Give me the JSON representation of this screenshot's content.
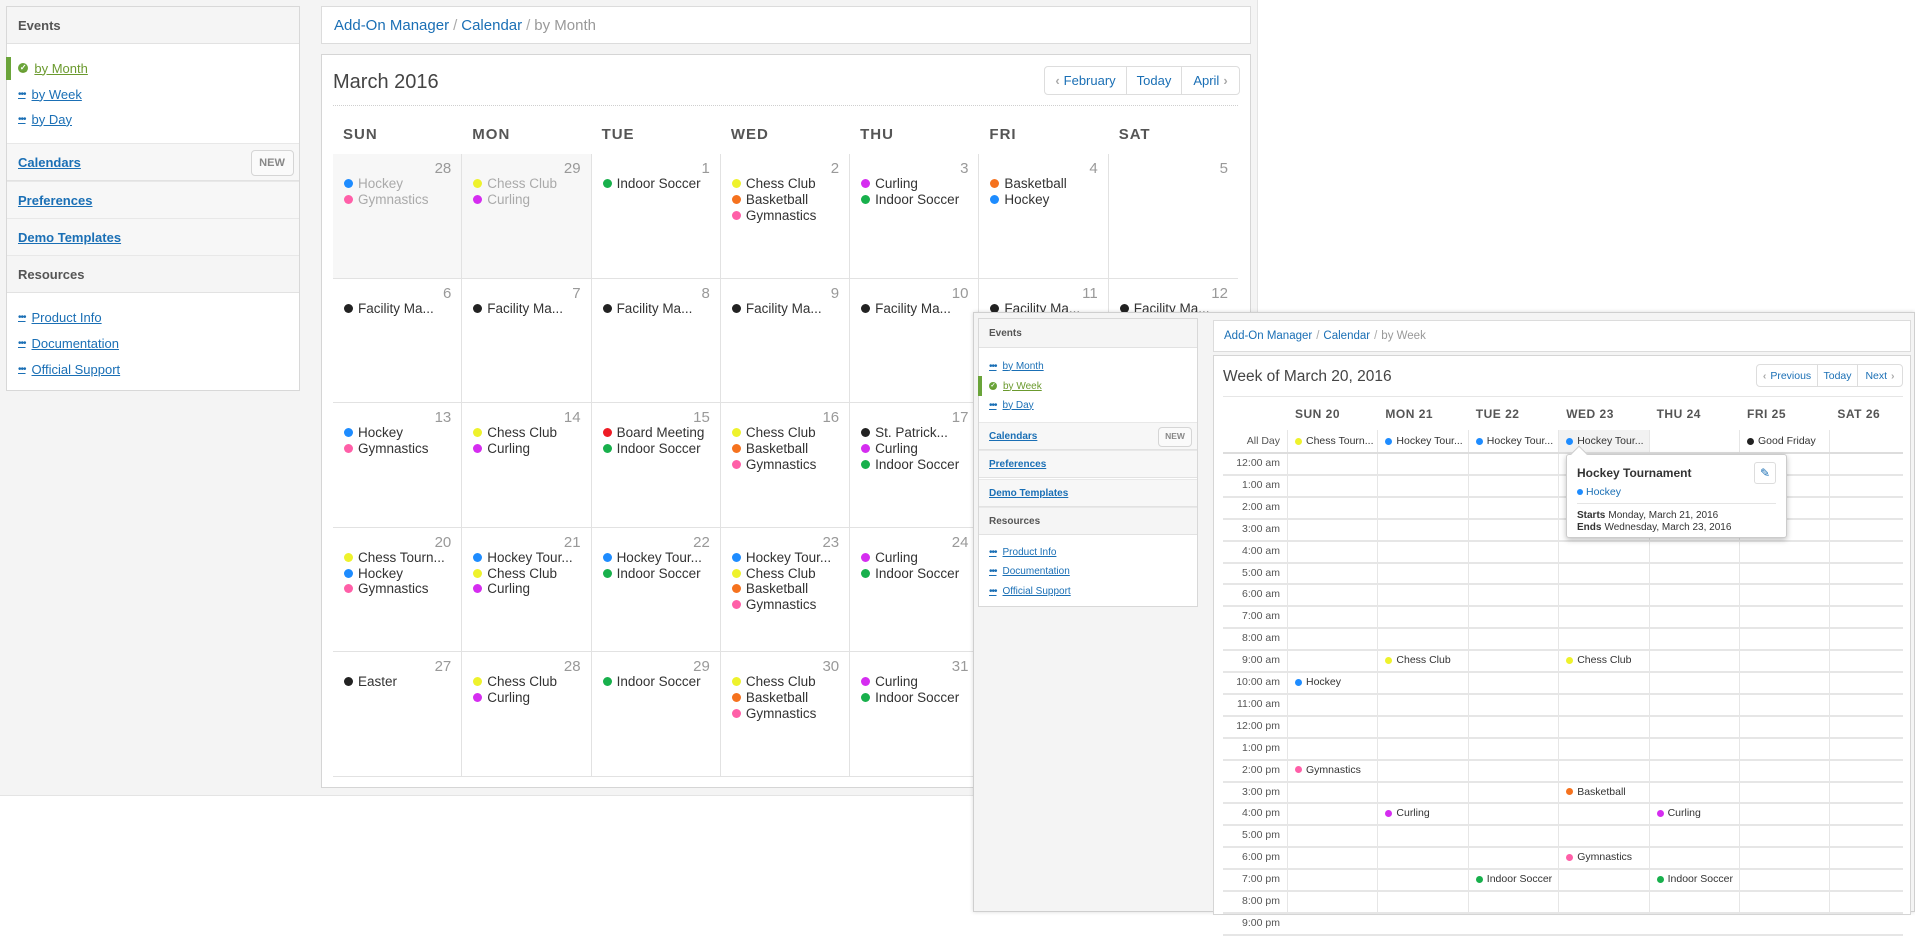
{
  "colors": {
    "accent": "#6aa43a",
    "link": "#1a6fb5",
    "Hockey": "#1e8cff",
    "Gymnastics": "#ff5fa8",
    "Chess Club": "#eef22c",
    "Curling": "#d52df0",
    "Indoor Soccer": "#18b04c",
    "Basketball": "#f5721e",
    "Board Meeting": "#ee1c25",
    "Other": "#222222"
  },
  "month_view": {
    "sidebar": {
      "events_header": "Events",
      "links": [
        {
          "label": "by Month",
          "active": true,
          "icon": "check-circle-icon"
        },
        {
          "label": "by Week",
          "active": false,
          "icon": "dots-icon"
        },
        {
          "label": "by Day",
          "active": false,
          "icon": "dots-icon"
        }
      ],
      "calendars": "Calendars",
      "new_button": "NEW",
      "preferences": "Preferences",
      "demo_templates": "Demo Templates",
      "resources_header": "Resources",
      "resources": [
        "Product Info",
        "Documentation",
        "Official Support"
      ]
    },
    "breadcrumb": {
      "item1": "Add-On Manager",
      "item2": "Calendar",
      "current": "by Month",
      "separator": "/"
    },
    "title": "March 2016",
    "nav": {
      "prev": "February",
      "today": "Today",
      "next": "April"
    },
    "weekdays": [
      "SUN",
      "MON",
      "TUE",
      "WED",
      "THU",
      "FRI",
      "SAT"
    ],
    "cells": [
      {
        "day": "28",
        "other": true,
        "events": [
          [
            "Hockey",
            "Hockey"
          ],
          [
            "Gymnastics",
            "Gymnastics"
          ]
        ]
      },
      {
        "day": "29",
        "other": true,
        "events": [
          [
            "Chess Club",
            "Chess Club"
          ],
          [
            "Curling",
            "Curling"
          ]
        ]
      },
      {
        "day": "1",
        "events": [
          [
            "Indoor Soccer",
            "Indoor Soccer"
          ]
        ]
      },
      {
        "day": "2",
        "events": [
          [
            "Chess Club",
            "Chess Club"
          ],
          [
            "Basketball",
            "Basketball"
          ],
          [
            "Gymnastics",
            "Gymnastics"
          ]
        ]
      },
      {
        "day": "3",
        "events": [
          [
            "Curling",
            "Curling"
          ],
          [
            "Indoor Soccer",
            "Indoor Soccer"
          ]
        ]
      },
      {
        "day": "4",
        "events": [
          [
            "Basketball",
            "Basketball"
          ],
          [
            "Hockey",
            "Hockey"
          ]
        ]
      },
      {
        "day": "5",
        "events": []
      },
      {
        "day": "6",
        "events": [
          [
            "Facility Ma...",
            "Other"
          ]
        ]
      },
      {
        "day": "7",
        "events": [
          [
            "Facility Ma...",
            "Other"
          ]
        ]
      },
      {
        "day": "8",
        "events": [
          [
            "Facility Ma...",
            "Other"
          ]
        ]
      },
      {
        "day": "9",
        "events": [
          [
            "Facility Ma...",
            "Other"
          ]
        ]
      },
      {
        "day": "10",
        "events": [
          [
            "Facility Ma...",
            "Other"
          ]
        ]
      },
      {
        "day": "11",
        "events": [
          [
            "Facility Ma...",
            "Other"
          ]
        ]
      },
      {
        "day": "12",
        "events": [
          [
            "Facility Ma...",
            "Other"
          ]
        ]
      },
      {
        "day": "13",
        "events": [
          [
            "Hockey",
            "Hockey"
          ],
          [
            "Gymnastics",
            "Gymnastics"
          ]
        ]
      },
      {
        "day": "14",
        "events": [
          [
            "Chess Club",
            "Chess Club"
          ],
          [
            "Curling",
            "Curling"
          ]
        ]
      },
      {
        "day": "15",
        "events": [
          [
            "Board Meeting",
            "Board Meeting"
          ],
          [
            "Indoor Soccer",
            "Indoor Soccer"
          ]
        ]
      },
      {
        "day": "16",
        "events": [
          [
            "Chess Club",
            "Chess Club"
          ],
          [
            "Basketball",
            "Basketball"
          ],
          [
            "Gymnastics",
            "Gymnastics"
          ]
        ]
      },
      {
        "day": "17",
        "events": [
          [
            "St. Patrick...",
            "Other"
          ],
          [
            "Curling",
            "Curling"
          ],
          [
            "Indoor Soccer",
            "Indoor Soccer"
          ]
        ]
      },
      {
        "day": "",
        "events": []
      },
      {
        "day": "",
        "events": []
      },
      {
        "day": "20",
        "events": [
          [
            "Chess Tourn...",
            "Chess Club"
          ],
          [
            "Hockey",
            "Hockey"
          ],
          [
            "Gymnastics",
            "Gymnastics"
          ]
        ]
      },
      {
        "day": "21",
        "events": [
          [
            "Hockey Tour...",
            "Hockey"
          ],
          [
            "Chess Club",
            "Chess Club"
          ],
          [
            "Curling",
            "Curling"
          ]
        ]
      },
      {
        "day": "22",
        "events": [
          [
            "Hockey Tour...",
            "Hockey"
          ],
          [
            "Indoor Soccer",
            "Indoor Soccer"
          ]
        ]
      },
      {
        "day": "23",
        "events": [
          [
            "Hockey Tour...",
            "Hockey"
          ],
          [
            "Chess Club",
            "Chess Club"
          ],
          [
            "Basketball",
            "Basketball"
          ],
          [
            "Gymnastics",
            "Gymnastics"
          ]
        ]
      },
      {
        "day": "24",
        "events": [
          [
            "Curling",
            "Curling"
          ],
          [
            "Indoor Soccer",
            "Indoor Soccer"
          ]
        ]
      },
      {
        "day": "",
        "events": []
      },
      {
        "day": "",
        "events": []
      },
      {
        "day": "27",
        "events": [
          [
            "Easter",
            "Other"
          ]
        ]
      },
      {
        "day": "28",
        "events": [
          [
            "Chess Club",
            "Chess Club"
          ],
          [
            "Curling",
            "Curling"
          ]
        ]
      },
      {
        "day": "29",
        "events": [
          [
            "Indoor Soccer",
            "Indoor Soccer"
          ]
        ]
      },
      {
        "day": "30",
        "events": [
          [
            "Chess Club",
            "Chess Club"
          ],
          [
            "Basketball",
            "Basketball"
          ],
          [
            "Gymnastics",
            "Gymnastics"
          ]
        ]
      },
      {
        "day": "31",
        "events": [
          [
            "Curling",
            "Curling"
          ],
          [
            "Indoor Soccer",
            "Indoor Soccer"
          ]
        ]
      },
      {
        "day": "",
        "events": []
      },
      {
        "day": "",
        "events": []
      }
    ]
  },
  "week_view": {
    "sidebar": {
      "events_header": "Events",
      "links": [
        {
          "label": "by Month",
          "active": false,
          "icon": "dots-icon"
        },
        {
          "label": "by Week",
          "active": true,
          "icon": "check-circle-icon"
        },
        {
          "label": "by Day",
          "active": false,
          "icon": "dots-icon"
        }
      ],
      "calendars": "Calendars",
      "new_button": "NEW",
      "preferences": "Preferences",
      "demo_templates": "Demo Templates",
      "resources_header": "Resources",
      "resources": [
        "Product Info",
        "Documentation",
        "Official Support"
      ]
    },
    "breadcrumb": {
      "item1": "Add-On Manager",
      "item2": "Calendar",
      "current": "by Week",
      "separator": "/"
    },
    "title": "Week of March 20, 2016",
    "nav": {
      "prev": "Previous",
      "today": "Today",
      "next": "Next"
    },
    "days": [
      "SUN 20",
      "MON 21",
      "TUE 22",
      "WED 23",
      "THU 24",
      "FRI 25",
      "SAT 26"
    ],
    "all_day_label": "All Day",
    "all_day": [
      [
        "Chess Tourn...",
        "Chess Club"
      ],
      [
        "Hockey Tour...",
        "Hockey"
      ],
      [
        "Hockey Tour...",
        "Hockey"
      ],
      [
        "Hockey Tour...",
        "Hockey"
      ],
      null,
      [
        "Good Friday",
        "Other"
      ],
      null
    ],
    "times": [
      "12:00 am",
      "1:00 am",
      "2:00 am",
      "3:00 am",
      "4:00 am",
      "5:00 am",
      "6:00 am",
      "7:00 am",
      "8:00 am",
      "9:00 am",
      "10:00 am",
      "11:00 am",
      "12:00 pm",
      "1:00 pm",
      "2:00 pm",
      "3:00 pm",
      "4:00 pm",
      "5:00 pm",
      "6:00 pm",
      "7:00 pm",
      "8:00 pm",
      "9:00 pm"
    ],
    "events": [
      {
        "day": 1,
        "hour": 9,
        "label": "Chess Club",
        "cal": "Chess Club"
      },
      {
        "day": 3,
        "hour": 9,
        "label": "Chess Club",
        "cal": "Chess Club"
      },
      {
        "day": 0,
        "hour": 10,
        "label": "Hockey",
        "cal": "Hockey"
      },
      {
        "day": 0,
        "hour": 14,
        "label": "Gymnastics",
        "cal": "Gymnastics"
      },
      {
        "day": 3,
        "hour": 15,
        "label": "Basketball",
        "cal": "Basketball"
      },
      {
        "day": 1,
        "hour": 16,
        "label": "Curling",
        "cal": "Curling"
      },
      {
        "day": 4,
        "hour": 16,
        "label": "Curling",
        "cal": "Curling"
      },
      {
        "day": 3,
        "hour": 18,
        "label": "Gymnastics",
        "cal": "Gymnastics"
      },
      {
        "day": 2,
        "hour": 19,
        "label": "Indoor Soccer",
        "cal": "Indoor Soccer"
      },
      {
        "day": 4,
        "hour": 19,
        "label": "Indoor Soccer",
        "cal": "Indoor Soccer"
      }
    ],
    "popover": {
      "title": "Hockey Tournament",
      "calendar": "Hockey",
      "starts_label": "Starts",
      "starts": "Monday, March 21, 2016",
      "ends_label": "Ends",
      "ends": "Wednesday, March 23, 2016"
    }
  }
}
